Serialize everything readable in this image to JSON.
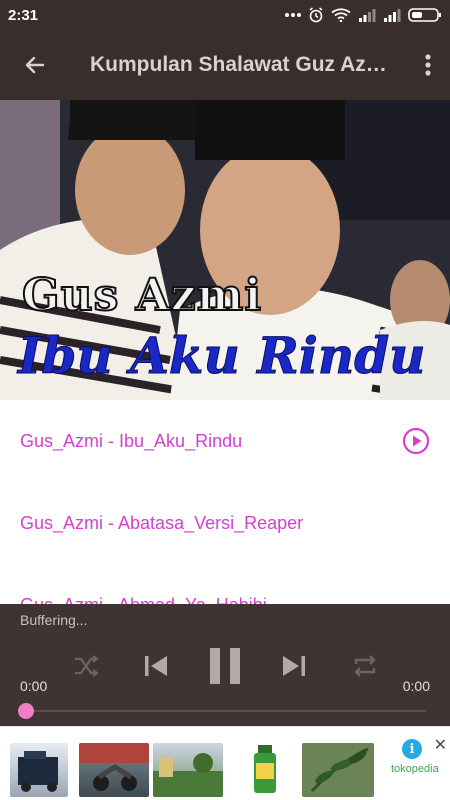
{
  "status_bar": {
    "time": "2:31",
    "icons": [
      "more-dots-icon",
      "alarm-icon",
      "wifi-icon",
      "signal-icon",
      "signal-icon",
      "battery-icon"
    ]
  },
  "app_bar": {
    "title": "Kumpulan Shalawat Guz Azmi",
    "back_icon": "arrow-left-icon",
    "menu_icon": "more-vert-icon"
  },
  "cover": {
    "artist_text": "Gus Azmi",
    "song_text": "Ibu Aku Rindu"
  },
  "playlist": {
    "tracks": [
      {
        "title": "Gus_Azmi - Ibu_Aku_Rindu",
        "playing": true
      },
      {
        "title": "Gus_Azmi - Abatasa_Versi_Reaper",
        "playing": false
      },
      {
        "title": "Gus_Azmi - Ahmad_Ya_Habibi",
        "playing": false
      }
    ],
    "accent_color": "#d53fd0"
  },
  "player": {
    "status": "Buffering...",
    "current_time": "0:00",
    "total_time": "0:00",
    "progress": 0,
    "controls": [
      "shuffle-icon",
      "skip-previous-icon",
      "pause-icon",
      "skip-next-icon",
      "repeat-icon"
    ],
    "background": "#3f3433",
    "thumb_color": "#ee7fc6"
  },
  "ad": {
    "brand": "tokopedia",
    "info_icon": "info-icon",
    "close_icon": "close-icon"
  }
}
